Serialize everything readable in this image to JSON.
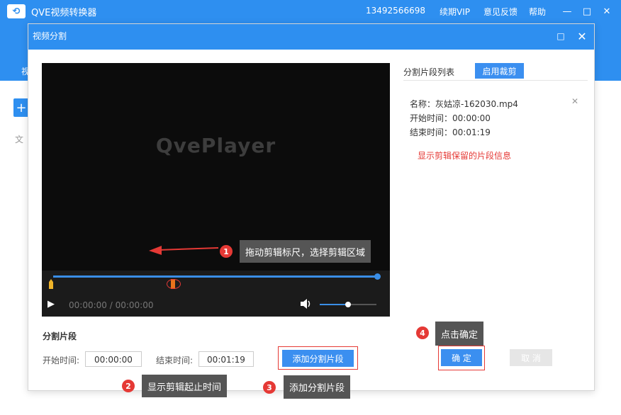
{
  "app": {
    "title": "QVE视频转换器",
    "phone": "13492566698",
    "vip": "续期VIP",
    "feedback": "意见反馈",
    "help": "帮助",
    "nav_fragment": "视",
    "file_fragment": "文"
  },
  "dialog": {
    "title": "视频分割"
  },
  "player": {
    "logo": "QvePlayer",
    "time": "00:00:00 / 00:00:00",
    "progress": 0.36,
    "volume": 0.5
  },
  "segment": {
    "title": "分割片段",
    "start_label": "开始时间:",
    "start_value": "00:00:00",
    "end_label": "结束时间:",
    "end_value": "00:01:19",
    "add_button": "添加分割片段"
  },
  "list": {
    "title": "分割片段列表",
    "enable_cut_button": "启用裁剪",
    "items": [
      {
        "name": "名称：灰姑凉-162030.mp4",
        "start": "开始时间：00:00:00",
        "end": "结束时间：00:01:19"
      }
    ],
    "hint": "显示剪辑保留的片段信息"
  },
  "actions": {
    "confirm": "确 定",
    "cancel": "取 消"
  },
  "annotations": [
    {
      "number": "1",
      "text": "拖动剪辑标尺，选择剪辑区域"
    },
    {
      "number": "2",
      "text": "显示剪辑起止时间"
    },
    {
      "number": "3",
      "text": "添加分割片段"
    },
    {
      "number": "4",
      "text": "点击确定"
    }
  ],
  "colors": {
    "accent": "#2e8ff0",
    "highlight": "#e53935"
  }
}
